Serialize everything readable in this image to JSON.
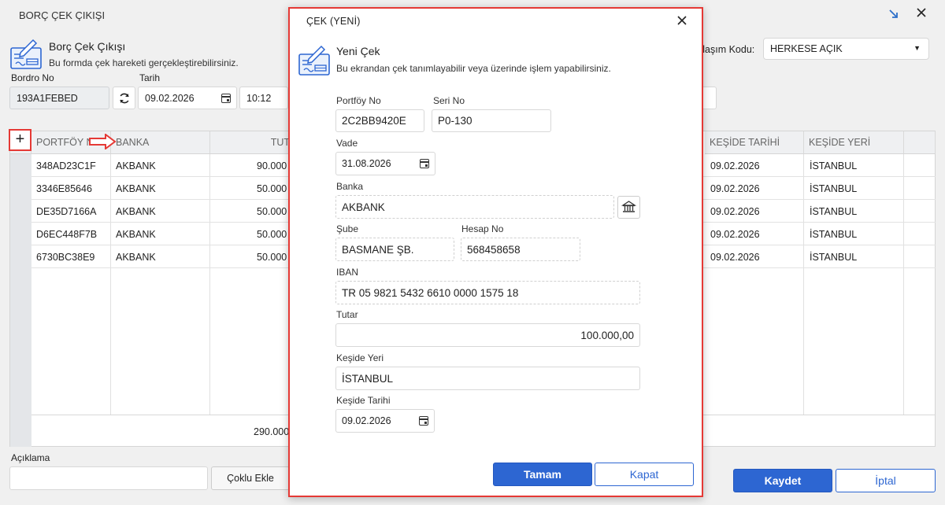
{
  "background": {
    "window_title": "BORÇ ÇEK ÇIKIŞI",
    "form_title": "Borç Çek Çıkışı",
    "form_desc": "Bu formda çek hareketi gerçekleştirebilirsiniz.",
    "bordro_label": "Bordro No",
    "bordro_value": "193A1FEBED",
    "tarih_label": "Tarih",
    "tarih_value": "09.02.2026",
    "time_value": "10:12",
    "share_label": "ylaşım Kodu:",
    "share_value": "HERKESE AÇIK",
    "add_label": "+",
    "columns": [
      "PORTFÖY NO",
      "BANKA",
      "TUT",
      "KEŞİDE TARİHİ",
      "KEŞİDE YERİ"
    ],
    "rows": [
      {
        "portfoy": "348AD23C1F",
        "banka": "AKBANK",
        "tutar": "90.000",
        "tarih": "09.02.2026",
        "yer": "İSTANBUL"
      },
      {
        "portfoy": "3346E85646",
        "banka": "AKBANK",
        "tutar": "50.000",
        "tarih": "09.02.2026",
        "yer": "İSTANBUL"
      },
      {
        "portfoy": "DE35D7166A",
        "banka": "AKBANK",
        "tutar": "50.000",
        "tarih": "09.02.2026",
        "yer": "İSTANBUL"
      },
      {
        "portfoy": "D6EC448F7B",
        "banka": "AKBANK",
        "tutar": "50.000",
        "tarih": "09.02.2026",
        "yer": "İSTANBUL"
      },
      {
        "portfoy": "6730BC38E9",
        "banka": "AKBANK",
        "tutar": "50.000",
        "tarih": "09.02.2026",
        "yer": "İSTANBUL"
      }
    ],
    "total": "290.000",
    "aciklama_label": "Açıklama",
    "coklu_label": "Çoklu Ekle",
    "kaydet_label": "Kaydet",
    "iptal_label": "İptal"
  },
  "modal": {
    "title": "ÇEK (YENİ)",
    "form_title": "Yeni Çek",
    "form_desc": "Bu ekrandan çek tanımlayabilir veya üzerinde işlem yapabilirsiniz.",
    "portfoy_label": "Portföy No",
    "portfoy_value": "2C2BB9420E",
    "seri_label": "Seri No",
    "seri_value": "P0-130",
    "vade_label": "Vade",
    "vade_value": "31.08.2026",
    "banka_label": "Banka",
    "banka_value": "AKBANK",
    "sube_label": "Şube",
    "sube_value": "BASMANE ŞB.",
    "hesap_label": "Hesap No",
    "hesap_value": "568458658",
    "iban_label": "IBAN",
    "iban_value": "TR 05 9821 5432 6610 0000 1575 18",
    "tutar_label": "Tutar",
    "tutar_value": "100.000,00",
    "keside_yeri_label": "Keşide Yeri",
    "keside_yeri_value": "İSTANBUL",
    "keside_tarihi_label": "Keşide Tarihi",
    "keside_tarihi_value": "09.02.2026",
    "tamam_label": "Tamam",
    "kapat_label": "Kapat"
  },
  "colors": {
    "primary": "#2d66d2",
    "highlight_red": "#e53935"
  }
}
